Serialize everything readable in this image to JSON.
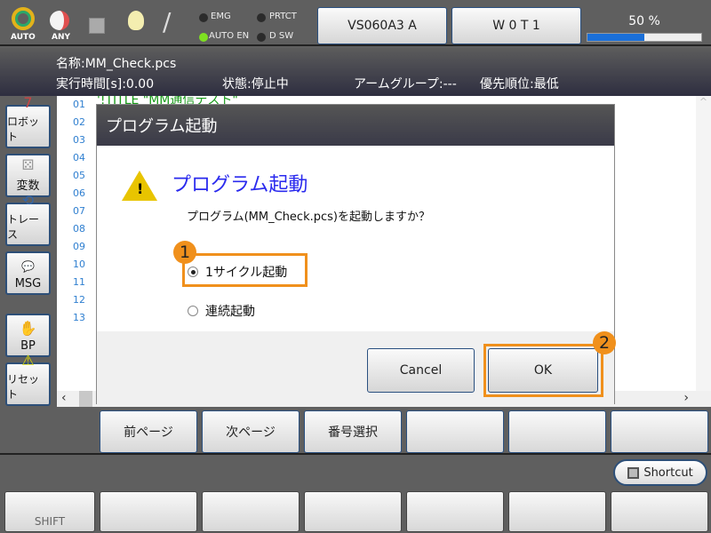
{
  "topbar": {
    "mode_auto": "AUTO",
    "mode_any": "ANY",
    "indicators": [
      {
        "label": "EMG",
        "on": false
      },
      {
        "label": "PRTCT",
        "on": false
      },
      {
        "label": "AUTO EN",
        "on": true
      },
      {
        "label": "D SW",
        "on": false
      }
    ],
    "robot_button": "VS060A3 A",
    "tool_button": "W 0 T 1",
    "speed_label": "50 %",
    "speed_percent": 50,
    "colors": {
      "progress": "#1a6fd8",
      "led_on": "#7ee021",
      "accent": "#f0901c"
    }
  },
  "info": {
    "name": "名称:MM_Check.pcs",
    "exec_time": "実行時間[s]:0.00",
    "state": "状態:停止中",
    "arm_group": "アームグループ:---",
    "priority": "優先順位:最低"
  },
  "sidebar": [
    {
      "label": "ロボット",
      "icon": "robot-icon"
    },
    {
      "label": "変数",
      "icon": "dice-icon"
    },
    {
      "label": "トレース",
      "icon": "trace-icon"
    },
    {
      "label": "MSG",
      "icon": "message-icon"
    },
    {
      "label": "BP",
      "icon": "hand-icon"
    },
    {
      "label": "リセット",
      "icon": "warning-icon"
    }
  ],
  "editor": {
    "line_numbers": [
      "01",
      "02",
      "03",
      "04",
      "05",
      "06",
      "07",
      "08",
      "09",
      "10",
      "11",
      "12",
      "13"
    ],
    "line1": "'!TITLE \"MM通信テスト\""
  },
  "dialog": {
    "title": "プログラム起動",
    "heading": "プログラム起動",
    "message": "プログラム(MM_Check.pcs)を起動しますか？",
    "options": [
      {
        "label": "1サイクル起動",
        "selected": true
      },
      {
        "label": "連続起動",
        "selected": false
      }
    ],
    "cancel": "Cancel",
    "ok": "OK",
    "badge1": "1",
    "badge2": "2"
  },
  "function_keys": [
    "前ページ",
    "次ページ",
    "番号選択",
    "",
    "",
    ""
  ],
  "shortcut": "Shortcut",
  "bottom_keys": [
    "SHIFT",
    "",
    "",
    "",
    "",
    "",
    ""
  ]
}
